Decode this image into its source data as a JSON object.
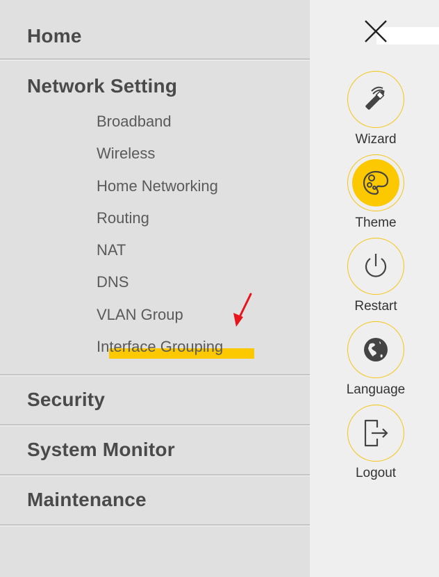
{
  "menu": {
    "sections": [
      {
        "label": "Home"
      },
      {
        "label": "Network Setting",
        "items": [
          {
            "label": "Broadband"
          },
          {
            "label": "Wireless"
          },
          {
            "label": "Home Networking"
          },
          {
            "label": "Routing"
          },
          {
            "label": "NAT"
          },
          {
            "label": "DNS"
          },
          {
            "label": "VLAN Group"
          },
          {
            "label": "Interface Grouping",
            "highlighted": true
          }
        ]
      },
      {
        "label": "Security"
      },
      {
        "label": "System Monitor"
      },
      {
        "label": "Maintenance"
      }
    ]
  },
  "side_panel": {
    "close_icon": "close-icon",
    "actions": [
      {
        "label": "Wizard",
        "icon": "wizard-wand-icon",
        "active": false
      },
      {
        "label": "Theme",
        "icon": "palette-icon",
        "active": true
      },
      {
        "label": "Restart",
        "icon": "power-icon",
        "active": false
      },
      {
        "label": "Language",
        "icon": "globe-icon",
        "active": false
      },
      {
        "label": "Logout",
        "icon": "logout-icon",
        "active": false
      }
    ]
  },
  "annotations": {
    "arrow_color": "#e8141c",
    "highlight_color": "#fcc800"
  },
  "colors": {
    "accent": "#fcc800",
    "menu_bg": "#e0e0e0",
    "panel_bg": "#efefef",
    "heading_text": "#4a4a4a",
    "item_text": "#5a5a5a"
  }
}
